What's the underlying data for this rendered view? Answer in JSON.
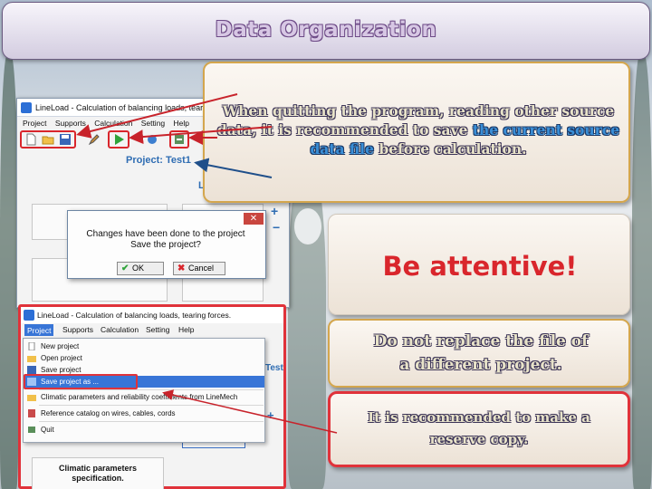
{
  "slide": {
    "title": "Data Organization"
  },
  "app_top": {
    "window_title": "LineLoad - Calculation of balancing loads, tearing",
    "menu": [
      "Project",
      "Supports",
      "Calculation",
      "Setting",
      "Help"
    ],
    "project_label": "Project: Test1",
    "panel_label": "L"
  },
  "dialog": {
    "close": "✕",
    "message_line1": "Changes have been done to the project",
    "message_line2": "Save the project?",
    "ok": "OK",
    "cancel": "Cancel"
  },
  "app_bottom": {
    "window_title": "LineLoad - Calculation of balancing loads, tearing forces.",
    "menu": [
      "Project",
      "Supports",
      "Calculation",
      "Setting",
      "Help"
    ],
    "project_tab_fragment": "Test",
    "dropdown": [
      "New project",
      "Open project",
      "Save project",
      "Save project as ...",
      "Climatic parameters and reliability coefficients from LineMech",
      "Reference catalog on wires, cables, cords",
      "Quit"
    ],
    "climatic_panel_line1": "Climatic parameters",
    "climatic_panel_line2": "specification."
  },
  "callouts": {
    "quit_note_part1": "When quitting the program, reading other source data, it is recommended to save",
    "quit_note_highlight": "the current source data file",
    "quit_note_part2": "before calculation.",
    "attentive": "Be attentive!",
    "replace_line1": "Do not replace the file of",
    "replace_line2": "a different project.",
    "reserve_line1": "It is recommended to make a",
    "reserve_line2": "reserve copy."
  },
  "colors": {
    "accent_red": "#e0323a",
    "highlight_blue": "#3a8fd7",
    "callout_border": "#d4a64d"
  }
}
